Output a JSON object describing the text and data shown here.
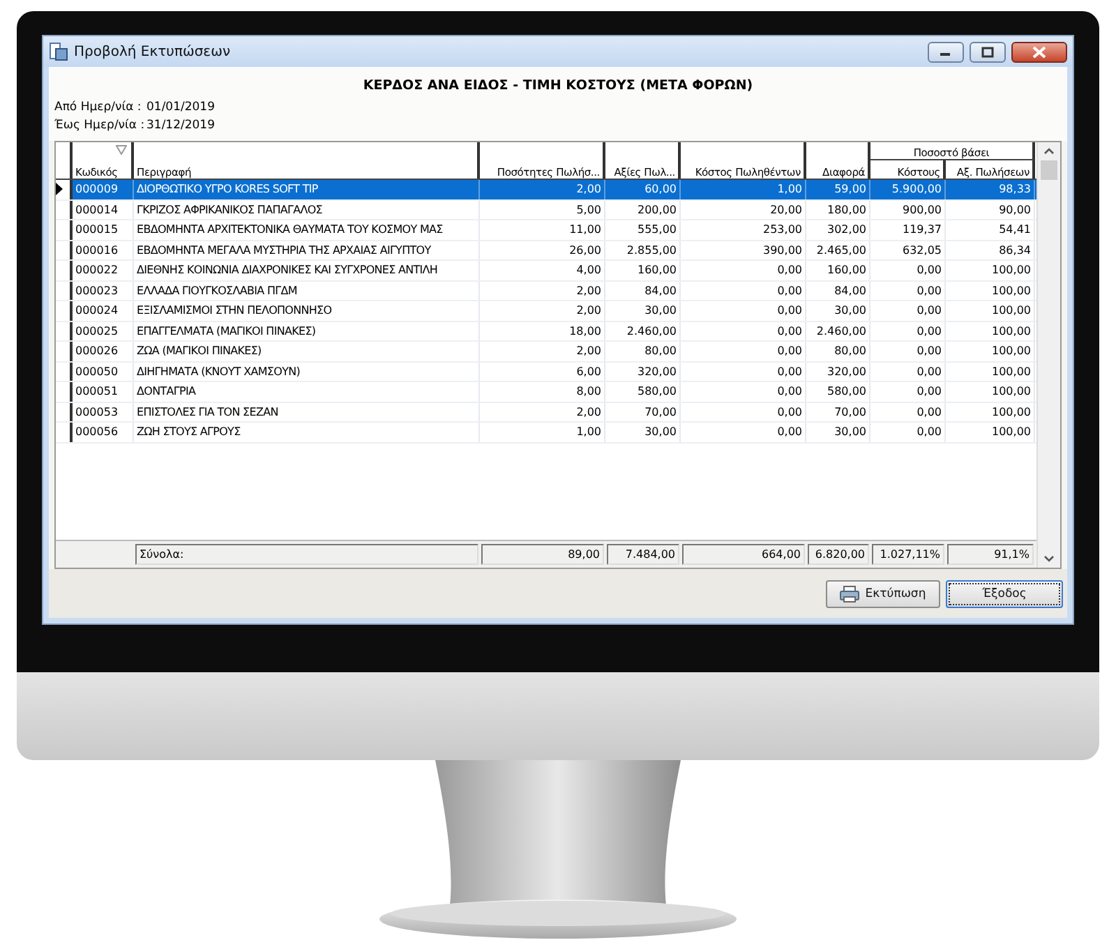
{
  "window": {
    "title": "Προβολή Εκτυπώσεων"
  },
  "report": {
    "title": "ΚΕΡΔΟΣ ΑΝΑ ΕΙΔΟΣ - ΤΙΜΗ ΚΟΣΤΟΥΣ (ΜΕΤΑ ΦΟΡΩΝ)",
    "fields": [
      {
        "label": "Από Ημερ/νία :",
        "value": "01/01/2019"
      },
      {
        "label": "Έως Ημερ/νία :",
        "value": "31/12/2019"
      }
    ]
  },
  "table": {
    "columns": [
      {
        "kind": "single",
        "label": "Κωδικός",
        "sorted": true
      },
      {
        "kind": "single",
        "label": "Περιγραφή",
        "sorted": false
      },
      {
        "kind": "single",
        "label": "Ποσότητες Πωλήσ...",
        "sorted": false
      },
      {
        "kind": "single",
        "label": "Αξίες Πωλ...",
        "sorted": false
      },
      {
        "kind": "single",
        "label": "Κόστος Πωληθέντων",
        "sorted": false
      },
      {
        "kind": "single",
        "label": "Διαφορά",
        "sorted": false
      },
      {
        "kind": "group",
        "label": "Ποσοστό βάσει",
        "children": [
          {
            "label": "Κόστους"
          },
          {
            "label": "Αξ. Πωλήσεων"
          }
        ]
      }
    ],
    "rows": [
      {
        "selected": true,
        "cells": [
          "000009",
          "ΔΙΟΡΘΩΤΙΚΟ ΥΓΡΟ KORES SOFT TIP",
          "2,00",
          "60,00",
          "1,00",
          "59,00",
          "5.900,00",
          "98,33"
        ]
      },
      {
        "selected": false,
        "cells": [
          "000014",
          "ΓΚΡΙΖΟΣ ΑΦΡΙΚΑΝΙΚΟΣ ΠΑΠΑΓΑΛΟΣ",
          "5,00",
          "200,00",
          "20,00",
          "180,00",
          "900,00",
          "90,00"
        ]
      },
      {
        "selected": false,
        "cells": [
          "000015",
          "ΕΒΔΟΜΗΝΤΑ ΑΡΧΙΤΕΚΤΟΝΙΚΑ ΘΑΥΜΑΤΑ ΤΟΥ ΚΟΣΜΟΥ ΜΑΣ",
          "11,00",
          "555,00",
          "253,00",
          "302,00",
          "119,37",
          "54,41"
        ]
      },
      {
        "selected": false,
        "cells": [
          "000016",
          "ΕΒΔΟΜΗΝΤΑ ΜΕΓΑΛΑ ΜΥΣΤΗΡΙΑ ΤΗΣ ΑΡΧΑΙΑΣ ΑΙΓΥΠΤΟΥ",
          "26,00",
          "2.855,00",
          "390,00",
          "2.465,00",
          "632,05",
          "86,34"
        ]
      },
      {
        "selected": false,
        "cells": [
          "000022",
          "ΔΙΕΘΝΗΣ ΚΟΙΝΩΝΙΑ ΔΙΑΧΡΟΝΙΚΕΣ ΚΑΙ ΣΥΓΧΡΟΝΕΣ ΑΝΤΙΛΗ",
          "4,00",
          "160,00",
          "0,00",
          "160,00",
          "0,00",
          "100,00"
        ]
      },
      {
        "selected": false,
        "cells": [
          "000023",
          "ΕΛΛΑΔΑ ΓΙΟΥΓΚΟΣΛΑΒΙΑ ΠΓΔΜ",
          "2,00",
          "84,00",
          "0,00",
          "84,00",
          "0,00",
          "100,00"
        ]
      },
      {
        "selected": false,
        "cells": [
          "000024",
          "ΕΞΙΣΛΑΜΙΣΜΟΙ ΣΤΗΝ ΠΕΛΟΠΟΝΝΗΣΟ",
          "2,00",
          "30,00",
          "0,00",
          "30,00",
          "0,00",
          "100,00"
        ]
      },
      {
        "selected": false,
        "cells": [
          "000025",
          "ΕΠΑΓΓΕΛΜΑΤΑ (ΜΑΓΙΚΟΙ ΠΙΝΑΚΕΣ)",
          "18,00",
          "2.460,00",
          "0,00",
          "2.460,00",
          "0,00",
          "100,00"
        ]
      },
      {
        "selected": false,
        "cells": [
          "000026",
          "ΖΩΑ (ΜΑΓΙΚΟΙ ΠΙΝΑΚΕΣ)",
          "2,00",
          "80,00",
          "0,00",
          "80,00",
          "0,00",
          "100,00"
        ]
      },
      {
        "selected": false,
        "cells": [
          "000050",
          "ΔΙΗΓΗΜΑΤΑ (ΚΝΟΥΤ ΧΑΜΣΟΥΝ)",
          "6,00",
          "320,00",
          "0,00",
          "320,00",
          "0,00",
          "100,00"
        ]
      },
      {
        "selected": false,
        "cells": [
          "000051",
          "ΔΟΝΤΑΓΡΙΑ",
          "8,00",
          "580,00",
          "0,00",
          "580,00",
          "0,00",
          "100,00"
        ]
      },
      {
        "selected": false,
        "cells": [
          "000053",
          "ΕΠΙΣΤΟΛΕΣ ΓΙΑ ΤΟΝ ΣΕΖΑΝ",
          "2,00",
          "70,00",
          "0,00",
          "70,00",
          "0,00",
          "100,00"
        ]
      },
      {
        "selected": false,
        "cells": [
          "000056",
          "ΖΩΗ ΣΤΟΥΣ ΑΓΡΟΥΣ",
          "1,00",
          "30,00",
          "0,00",
          "30,00",
          "0,00",
          "100,00"
        ]
      }
    ],
    "totals": {
      "label": "Σύνολα:",
      "values": [
        "89,00",
        "7.484,00",
        "664,00",
        "6.820,00",
        "1.027,11%",
        "91,1%"
      ]
    }
  },
  "buttons": [
    {
      "kind": "print",
      "label": "Εκτύπωση",
      "focused": false
    },
    {
      "kind": "exit",
      "label": "Έξοδος",
      "focused": true
    }
  ]
}
